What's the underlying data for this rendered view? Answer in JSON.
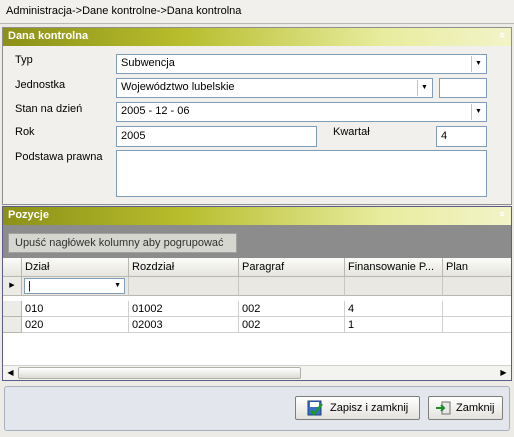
{
  "breadcrumb": "Administracja->Dane  kontrolne->Dana kontrolna",
  "panel_dana": {
    "title": "Dana kontrolna",
    "collapse_glyph": "«",
    "fields": {
      "typ": {
        "label": "Typ",
        "value": "Subwencja"
      },
      "jednostka": {
        "label": "Jednostka",
        "value": "Województwo lubelskie",
        "extra": ""
      },
      "stan": {
        "label": "Stan na dzień",
        "value": "2005 - 12 - 06"
      },
      "rok": {
        "label": "Rok",
        "value": "2005"
      },
      "kwartal": {
        "label": "Kwartał",
        "value": "4"
      },
      "podstawa": {
        "label": "Podstawa prawna",
        "value": ""
      }
    }
  },
  "panel_pozycje": {
    "title": "Pozycje",
    "collapse_glyph": "«",
    "group_hint": "Upuść nagłówek kolumny aby pogrupować",
    "columns": [
      "Dział",
      "Rozdział",
      "Paragraf",
      "Finansowanie P...",
      "Plan"
    ],
    "rows": [
      [
        "010",
        "01002",
        "002",
        "4",
        ""
      ],
      [
        "020",
        "02003",
        "002",
        "1",
        ""
      ]
    ]
  },
  "footer": {
    "save_label": "Zapisz i zamknij",
    "close_label": "Zamknij"
  },
  "colors": {
    "header_dark": "#8c9018",
    "header_light": "#e8ec9e",
    "border_blue": "#7f9db9"
  },
  "icons": {
    "save": "save-close-icon",
    "close": "exit-icon"
  }
}
